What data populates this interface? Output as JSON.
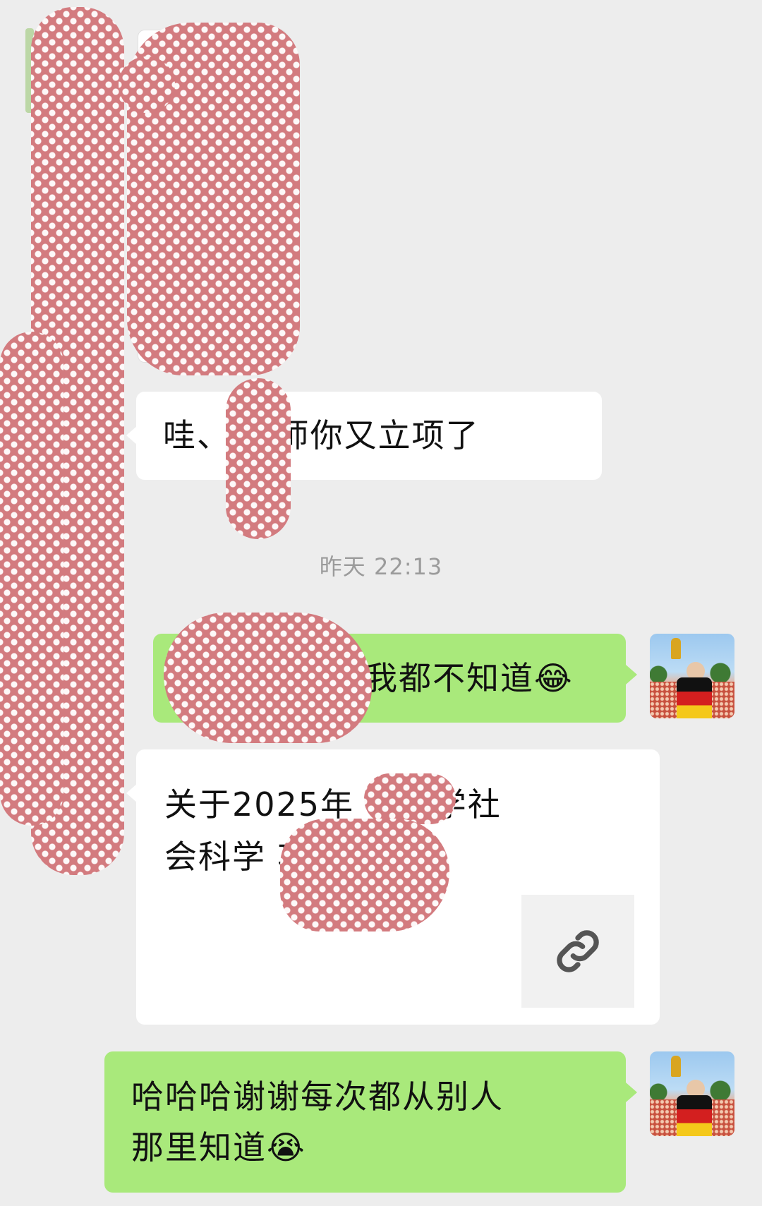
{
  "messages": {
    "incoming_1": {
      "text": "哇、 老师你又立项了"
    },
    "timestamp": "昨天 22:13",
    "outgoing_1": {
      "text": "我都不知道😂"
    },
    "incoming_link": {
      "title_line1": "关于2025年 市哲学社",
      "title_line2": "会科学 项目立…",
      "thumb_icon": "link-icon"
    },
    "outgoing_2": {
      "text": "哈哈哈谢谢每次都从别人\n那里知道😭"
    }
  },
  "colors": {
    "background": "#ededed",
    "incoming_bubble": "#ffffff",
    "outgoing_bubble": "#a9e97b",
    "redaction": "#d37b7f"
  }
}
